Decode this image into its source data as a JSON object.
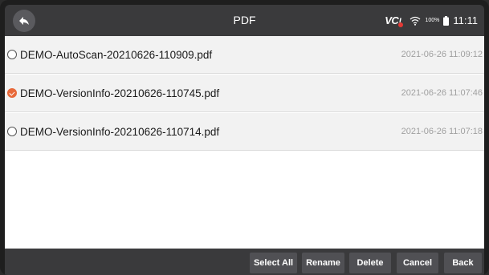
{
  "header": {
    "title": "PDF",
    "vci_label": "VCI",
    "battery_text": "100%",
    "time": "11:11"
  },
  "files": [
    {
      "name": "DEMO-AutoScan-20210626-110909.pdf",
      "date": "2021-06-26 11:09:12",
      "selected": false
    },
    {
      "name": "DEMO-VersionInfo-20210626-110745.pdf",
      "date": "2021-06-26 11:07:46",
      "selected": true
    },
    {
      "name": "DEMO-VersionInfo-20210626-110714.pdf",
      "date": "2021-06-26 11:07:18",
      "selected": false
    }
  ],
  "toolbar": {
    "select_all": "Select All",
    "rename": "Rename",
    "delete": "Delete",
    "cancel": "Cancel",
    "back": "Back"
  },
  "colors": {
    "accent": "#e8693a",
    "bar": "#3a3a3c",
    "button": "#505054"
  }
}
